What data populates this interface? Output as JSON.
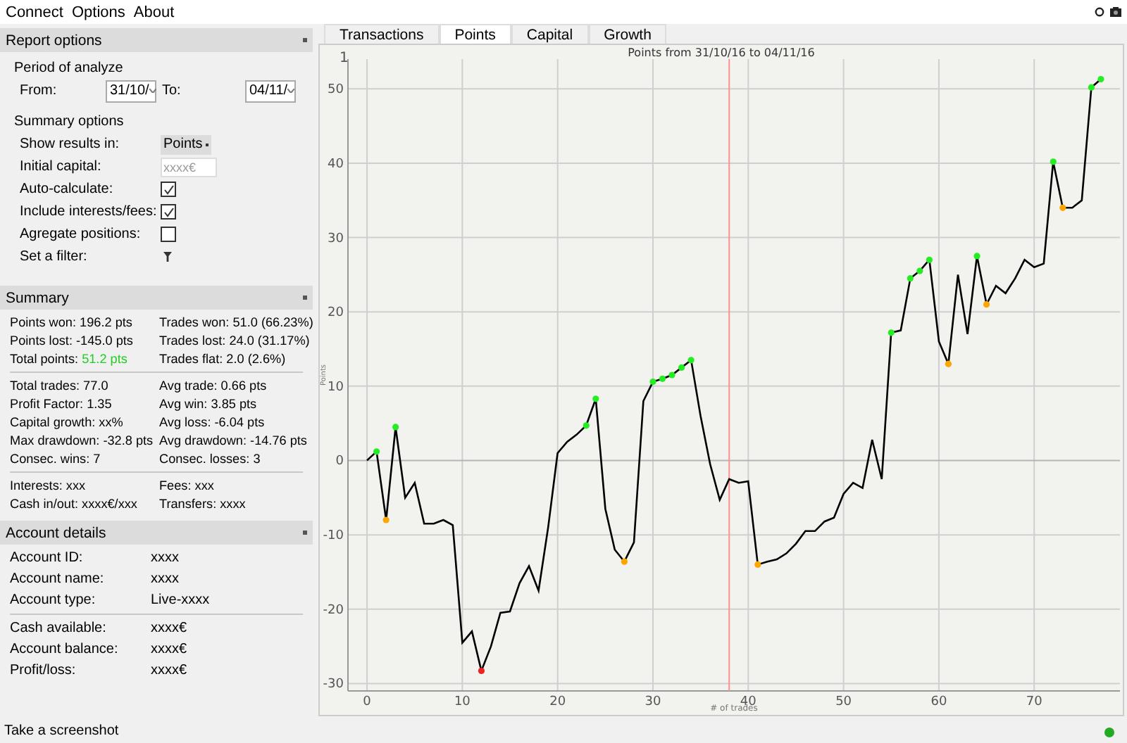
{
  "menu": [
    "Connect",
    "Options",
    "About"
  ],
  "report_options": {
    "title": "Report options",
    "period": {
      "title": "Period of analyze",
      "from_label": "From:",
      "from_value": "31/10/",
      "to_label": "To:",
      "to_value": "04/11/"
    },
    "summary_options": {
      "title": "Summary options",
      "rows": [
        {
          "kind": "select",
          "label": "Show results in:",
          "value": "Points"
        },
        {
          "kind": "input",
          "label": "Initial capital:",
          "placeholder": "xxxx€"
        },
        {
          "kind": "checkbox",
          "label": "Auto-calculate:",
          "checked": true
        },
        {
          "kind": "checkbox",
          "label": "Include interests/fees:",
          "checked": true
        },
        {
          "kind": "checkbox",
          "label": "Agregate positions:",
          "checked": false
        },
        {
          "kind": "filter",
          "label": "Set a filter:"
        }
      ]
    }
  },
  "summary": {
    "title": "Summary",
    "groups": [
      [
        {
          "text": "Points won: 196.2 pts"
        },
        {
          "text": "Trades won: 51.0 (66.23%)"
        },
        {
          "text": "Points lost: -145.0 pts"
        },
        {
          "text": "Trades lost: 24.0 (31.17%)"
        },
        {
          "text": "Total points:",
          "value": "51.2 pts",
          "color": "#22cc22"
        },
        {
          "text": "Trades flat: 2.0 (2.6%)"
        }
      ],
      [
        {
          "text": "Total trades: 77.0"
        },
        {
          "text": "Avg trade: 0.66 pts"
        },
        {
          "text": "Profit Factor: 1.35"
        },
        {
          "text": "Avg win: 3.85 pts"
        },
        {
          "text": "Capital growth: xx%"
        },
        {
          "text": "Avg loss: -6.04 pts"
        },
        {
          "text": "Max drawdown: -32.8 pts"
        },
        {
          "text": "Avg drawdown: -14.76 pts"
        },
        {
          "text": "Consec. wins: 7"
        },
        {
          "text": "Consec. losses: 3"
        }
      ],
      [
        {
          "text": "Interests: xxx"
        },
        {
          "text": "Fees: xxx"
        },
        {
          "text": "Cash in/out: xxxx€/xxx"
        },
        {
          "text": "Transfers: xxxx"
        }
      ]
    ]
  },
  "account_details": {
    "title": "Account details",
    "groups": [
      [
        {
          "label": "Account ID:",
          "value": "xxxx"
        },
        {
          "label": "Account name:",
          "value": "xxxx"
        },
        {
          "label": "Account type:",
          "value": "Live-xxxx"
        }
      ],
      [
        {
          "label": "Cash available:",
          "value": "xxxx€"
        },
        {
          "label": "Account balance:",
          "value": "xxxx€"
        },
        {
          "label": "Profit/loss:",
          "value": "xxxx€"
        }
      ]
    ]
  },
  "status_bar": {
    "text": "Take a screenshot",
    "connected": true
  },
  "tabs": [
    {
      "label": "Transactions",
      "selected": false
    },
    {
      "label": "Points",
      "selected": true
    },
    {
      "label": "Capital",
      "selected": false
    },
    {
      "label": "Growth",
      "selected": false
    }
  ],
  "chart_corner_label": "1",
  "chart_data": {
    "type": "line",
    "title": "Points from 31/10/16 to 04/11/16",
    "xlabel": "# of trades",
    "ylabel": "Points",
    "x": [
      0,
      1,
      2,
      3,
      4,
      5,
      6,
      7,
      8,
      9,
      10,
      11,
      12,
      13,
      14,
      15,
      16,
      17,
      18,
      19,
      20,
      21,
      22,
      23,
      24,
      25,
      26,
      27,
      28,
      29,
      30,
      31,
      32,
      33,
      34,
      35,
      36,
      37,
      38,
      39,
      40,
      41,
      42,
      43,
      44,
      45,
      46,
      47,
      48,
      49,
      50,
      51,
      52,
      53,
      54,
      55,
      56,
      57,
      58,
      59,
      60,
      61,
      62,
      63,
      64,
      65,
      66,
      67,
      68,
      69,
      70,
      71,
      72,
      73,
      74,
      75,
      76,
      77
    ],
    "series": [
      {
        "color": "#000000",
        "values": [
          0,
          1.2,
          -8,
          4.5,
          -5,
          -3,
          -8.5,
          -8.5,
          -8,
          -8.7,
          -24.5,
          -23,
          -28.3,
          -25,
          -20.5,
          -20.3,
          -16.5,
          -14.2,
          -17.5,
          -9,
          1,
          2.5,
          3.5,
          4.7,
          8.3,
          -6.5,
          -12,
          -13.6,
          -11,
          8,
          10.6,
          11,
          11.5,
          12.5,
          13.5,
          6,
          -0.5,
          -5.3,
          -2.5,
          -3,
          -2.8,
          -14,
          -13.6,
          -13.3,
          -12.5,
          -11.2,
          -9.5,
          -9.5,
          -8.2,
          -7.7,
          -4.5,
          -3,
          -3.7,
          2.8,
          -2.5,
          17.2,
          17.5,
          24.5,
          25.5,
          27,
          16,
          13,
          25,
          17,
          27.5,
          21,
          23.5,
          22.5,
          24.5,
          27,
          26,
          26.5,
          40.2,
          34,
          34,
          35,
          50.2,
          51.3
        ]
      },
      {
        "type": "scatter",
        "color": "#22ee22",
        "marker": "circle",
        "values": [
          null,
          1.2,
          null,
          4.5,
          null,
          null,
          null,
          null,
          null,
          null,
          null,
          null,
          null,
          null,
          null,
          null,
          null,
          null,
          null,
          null,
          null,
          null,
          null,
          4.7,
          8.3,
          null,
          null,
          null,
          null,
          null,
          10.6,
          11,
          11.5,
          12.5,
          13.5,
          null,
          null,
          null,
          null,
          null,
          null,
          null,
          null,
          null,
          null,
          null,
          null,
          null,
          null,
          null,
          null,
          null,
          null,
          null,
          null,
          17.2,
          null,
          24.5,
          25.5,
          27,
          null,
          null,
          null,
          null,
          27.5,
          null,
          null,
          null,
          null,
          null,
          null,
          null,
          40.2,
          null,
          null,
          null,
          50.2,
          51.3
        ]
      },
      {
        "type": "scatter",
        "color": "#ffa500",
        "marker": "circle",
        "values": [
          null,
          null,
          -8,
          null,
          null,
          null,
          null,
          null,
          null,
          null,
          null,
          null,
          null,
          null,
          null,
          null,
          null,
          null,
          null,
          null,
          null,
          null,
          null,
          null,
          null,
          null,
          null,
          -13.6,
          null,
          null,
          null,
          null,
          null,
          null,
          null,
          null,
          null,
          null,
          null,
          null,
          null,
          -14,
          null,
          null,
          null,
          null,
          null,
          null,
          null,
          null,
          null,
          null,
          null,
          null,
          null,
          null,
          null,
          null,
          null,
          null,
          null,
          13,
          null,
          null,
          null,
          21,
          null,
          null,
          null,
          null,
          null,
          null,
          null,
          34,
          null,
          null,
          null,
          null
        ]
      },
      {
        "type": "scatter",
        "color": "#ee2222",
        "marker": "circle",
        "values": [
          null,
          null,
          null,
          null,
          null,
          null,
          null,
          null,
          null,
          null,
          null,
          null,
          -28.3,
          null,
          null,
          null,
          null,
          null,
          null,
          null,
          null,
          null,
          null,
          null,
          null,
          null,
          null,
          null,
          null,
          null,
          null,
          null,
          null,
          null,
          null,
          null,
          null,
          null,
          null,
          null,
          null,
          null,
          null,
          null,
          null,
          null,
          null,
          null,
          null,
          null,
          null,
          null,
          null,
          null,
          null,
          null,
          null,
          null,
          null,
          null,
          null,
          null,
          null,
          null,
          null,
          null,
          null,
          null,
          null,
          null,
          null,
          null,
          null,
          null,
          null,
          null,
          null,
          null
        ]
      }
    ],
    "xlim": [
      -2,
      79
    ],
    "ylim": [
      -31,
      54
    ],
    "xticks": [
      0,
      10,
      20,
      30,
      40,
      50,
      60,
      70
    ],
    "yticks": [
      -30,
      -20,
      -10,
      0,
      10,
      20,
      30,
      40,
      50
    ],
    "grid": true,
    "ref_lines": [
      {
        "axis": "x",
        "value": 38
      }
    ]
  }
}
